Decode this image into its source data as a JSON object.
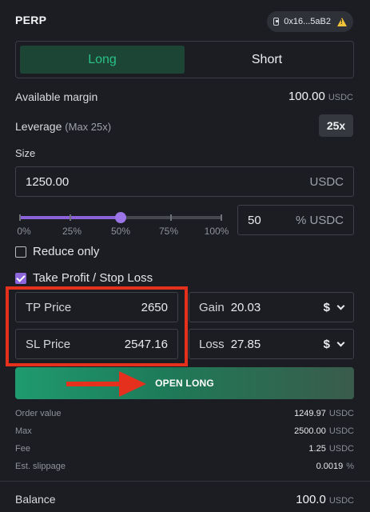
{
  "header": {
    "title": "PERP",
    "wallet": {
      "icon": "wallet-icon",
      "address": "0x16...5aB2",
      "warning_icon": "warning-icon"
    }
  },
  "side": {
    "long_label": "Long",
    "short_label": "Short",
    "selected": "Long"
  },
  "margin": {
    "label": "Available margin",
    "value": "100.00",
    "unit": "USDC"
  },
  "leverage": {
    "label": "Leverage",
    "max_text": "(Max 25x)",
    "value": "25x"
  },
  "size": {
    "label": "Size",
    "value": "1250.00",
    "unit": "USDC"
  },
  "slider": {
    "percent": 50,
    "ticks": [
      "0%",
      "25%",
      "50%",
      "75%",
      "100%"
    ]
  },
  "percent_input": {
    "value": "50",
    "unit": "% USDC"
  },
  "reduce_only": {
    "label": "Reduce only",
    "checked": false
  },
  "tpsl": {
    "label": "Take Profit / Stop Loss",
    "checked": true,
    "tp": {
      "label": "TP Price",
      "value": "2650"
    },
    "sl": {
      "label": "SL Price",
      "value": "2547.16"
    },
    "gain": {
      "label": "Gain",
      "value": "20.03",
      "currency": "$"
    },
    "loss": {
      "label": "Loss",
      "value": "27.85",
      "currency": "$"
    }
  },
  "action": {
    "label": "OPEN LONG"
  },
  "summary": [
    {
      "label": "Order value",
      "value": "1249.97",
      "unit": "USDC"
    },
    {
      "label": "Max",
      "value": "2500.00",
      "unit": "USDC"
    },
    {
      "label": "Fee",
      "value": "1.25",
      "unit": "USDC"
    },
    {
      "label": "Est. slippage",
      "value": "0.0019",
      "unit": "%"
    }
  ],
  "balance": {
    "label": "Balance",
    "value": "100.0",
    "unit": "USDC"
  },
  "colors": {
    "long": "#29c188",
    "accent": "#8d66dc",
    "highlight": "#e5301e",
    "background": "#1b1d22"
  }
}
